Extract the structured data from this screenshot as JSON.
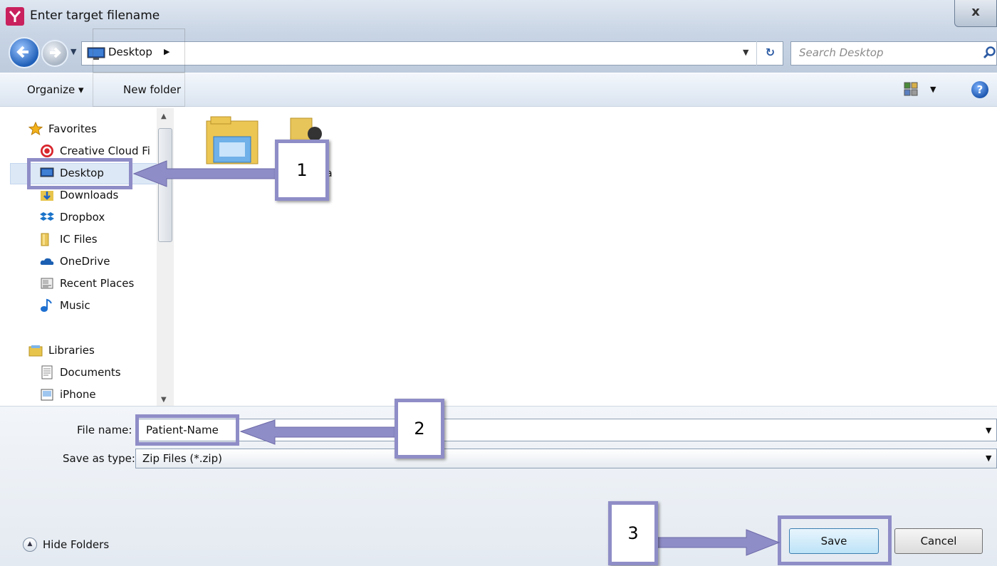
{
  "window": {
    "title": "Enter target filename",
    "close_label": "x"
  },
  "address": {
    "location": "Desktop",
    "search_placeholder": "Search Desktop"
  },
  "toolbar": {
    "organize_label": "Organize ▾",
    "new_folder_label": "New folder",
    "help_label": "?"
  },
  "sidebar": {
    "favorites": [
      {
        "label": "Favorites",
        "icon": "star-icon"
      },
      {
        "label": "Creative Cloud Fi",
        "icon": "creative-cloud-icon"
      },
      {
        "label": "Desktop",
        "icon": "desktop-icon"
      },
      {
        "label": "Downloads",
        "icon": "downloads-icon"
      },
      {
        "label": "Dropbox",
        "icon": "dropbox-icon"
      },
      {
        "label": "IC Files",
        "icon": "folder-icon"
      },
      {
        "label": "OneDrive",
        "icon": "onedrive-icon"
      },
      {
        "label": "Recent Places",
        "icon": "recent-places-icon"
      },
      {
        "label": "Music",
        "icon": "music-icon"
      }
    ],
    "libraries": [
      {
        "label": "Libraries",
        "icon": "libraries-icon"
      },
      {
        "label": "Documents",
        "icon": "documents-icon"
      },
      {
        "label": "iPhone",
        "icon": "iphone-icon"
      }
    ]
  },
  "content": {
    "partial_label": "a"
  },
  "form": {
    "file_name_label": "File name:",
    "file_name_value": "Patient-Name",
    "save_as_label": "Save as type:",
    "save_as_value": "Zip Files (*.zip)"
  },
  "footer": {
    "hide_folders_label": "Hide Folders",
    "save_label": "Save",
    "cancel_label": "Cancel"
  },
  "callouts": [
    "1",
    "2",
    "3"
  ],
  "colors": {
    "callout_border": "#8f8dc7",
    "titlebar": "#c9d5e5",
    "save_button": "#bde3f8"
  }
}
